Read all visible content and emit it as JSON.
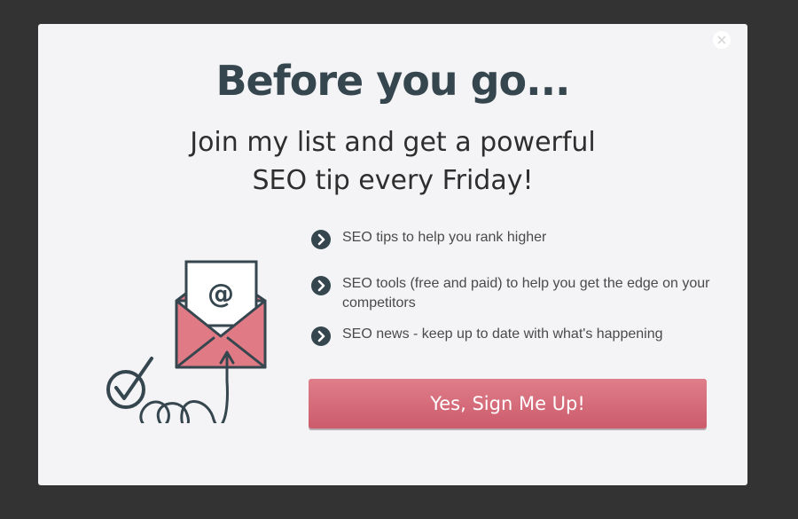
{
  "popup": {
    "headline": "Before you go...",
    "subheadline_line1": "Join my list and get a powerful",
    "subheadline_line2": "SEO tip every Friday!",
    "benefits": [
      "SEO tips to help you rank higher",
      "SEO tools (free and paid) to help you get the edge on your competitors",
      "SEO news - keep up to date with what's happening"
    ],
    "cta_label": "Yes, Sign Me Up!",
    "illustration_at_symbol": "@"
  },
  "icons": {
    "close": "close-icon",
    "bullet": "chevron-right-circle-icon",
    "illustration": "envelope-illustration",
    "check": "checkmark-circle-icon"
  },
  "colors": {
    "overlay": "#333333",
    "modal_background": "#f4f4f6",
    "heading_text": "#36464f",
    "cta_top": "#df7e8a",
    "cta_bottom": "#cc5b6c",
    "envelope": "#e07a85"
  }
}
